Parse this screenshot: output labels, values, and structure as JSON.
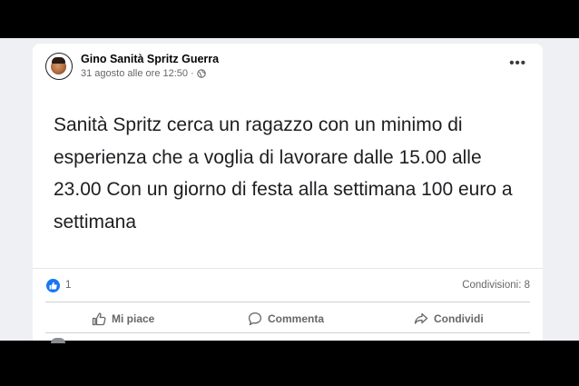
{
  "post": {
    "author": "Gino Sanità Spritz Guerra",
    "timestamp": "31 agosto alle ore 12:50",
    "separator": "·",
    "audience_icon": "globe-icon",
    "more_label": "•••",
    "text": "Sanità Spritz cerca un ragazzo con un minimo di esperienza che a voglia di lavorare dalle 15.00 alle 23.00 Con un giorno di festa alla settimana 100 euro a settimana"
  },
  "stats": {
    "reaction_icon": "like-icon",
    "like_count": "1",
    "shares": "Condivisioni: 8"
  },
  "actions": {
    "like": "Mi piace",
    "comment": "Commenta",
    "share": "Condividi"
  },
  "colors": {
    "accent": "#1877f2",
    "secondary_text": "#65676b",
    "background": "#eef0f3"
  }
}
